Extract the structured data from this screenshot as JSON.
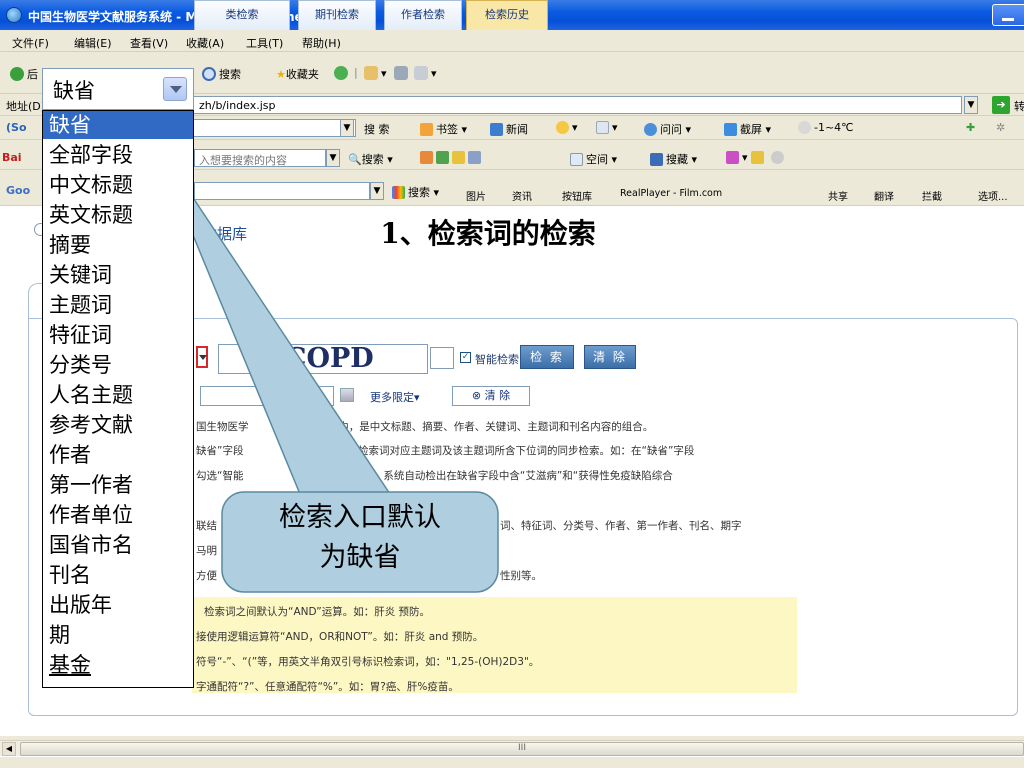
{
  "window": {
    "title": "中国生物医学文献服务系统 - Microsoft Internet Explorer"
  },
  "menu": [
    "文件(F)",
    "编辑(E)",
    "查看(V)",
    "收藏(A)",
    "工具(T)",
    "帮助(H)"
  ],
  "toolbar": {
    "back": "后",
    "search": "搜索",
    "favorites": "收藏夹"
  },
  "address": {
    "label": "地址(D)",
    "value": "zh/b/index.jsp",
    "go_label": "转"
  },
  "sogou_bar": {
    "search_btn": "搜 索",
    "bookmarks": "书签",
    "news": "新闻",
    "ask": "问问",
    "screenshot": "截屏",
    "weather": "-1~4℃"
  },
  "baidu_bar": {
    "placeholder": "入想要搜索的内容",
    "search_btn": "搜索",
    "space": "空间",
    "collect": "搜藏"
  },
  "google_bar": {
    "search": "搜索",
    "images": "图片",
    "news": "资讯",
    "buttons": "按钮库",
    "realplayer": "RealPlayer - Film.com",
    "share": "共享",
    "translate": "翻译",
    "block": "拦截",
    "options": "选项..."
  },
  "page": {
    "db_title": "数据库",
    "slide_title": "1、检索词的检索",
    "tabs": [
      "类检索",
      "期刊检索",
      "作者检索",
      "检索历史"
    ],
    "search_value": "COPD",
    "smart_search": "智能检索",
    "search_btn": "检 索",
    "clear_btn": "清 除",
    "more_limit": "更多限定▾",
    "clear2": "⊗ 清 除",
    "help_lines": [
      "国生物医学",
      "库(CBM)中，是中文标题、摘要、作者、关键词、主题词和刊名内容的组合。",
      "缺省”字段",
      "检索词、检索词对应主题词及该主题词所含下位词的同步检索。如：在“缺省”字段",
      "勾选“智能",
      "“检索”按钮，系统自动检出在缺省字段中含“艾滋病”和“获得性免疫缺陷综合",
      "联结",
      "词、特征词、分类号、作者、第一作者、刊名、期字",
      "马明",
      "方便",
      "性别等。"
    ],
    "tips": [
      "检索词之间默认为“AND”运算。如：肝炎 预防。",
      "接使用逻辑运算符“AND，OR和NOT”。如：肝炎 and 预防。",
      "符号“-”、“(”等，用英文半角双引号标识检索词，如：\"1,25-(OH)2D3\"。",
      "字通配符“?”、任意通配符“%”。如：胃?癌、肝%疫苗。"
    ]
  },
  "dropdown": {
    "selected": "缺省",
    "options": [
      "缺省",
      "全部字段",
      "中文标题",
      "英文标题",
      "摘要",
      "关键词",
      "主题词",
      "特征词",
      "分类号",
      "人名主题",
      "参考文献",
      "作者",
      "第一作者",
      "作者单位",
      "国省市名",
      "刊名",
      "出版年",
      "期",
      "基金"
    ]
  },
  "callout": {
    "line1": "检索入口默认",
    "line2": "为缺省"
  },
  "scroll": {
    "thumb": "III"
  }
}
